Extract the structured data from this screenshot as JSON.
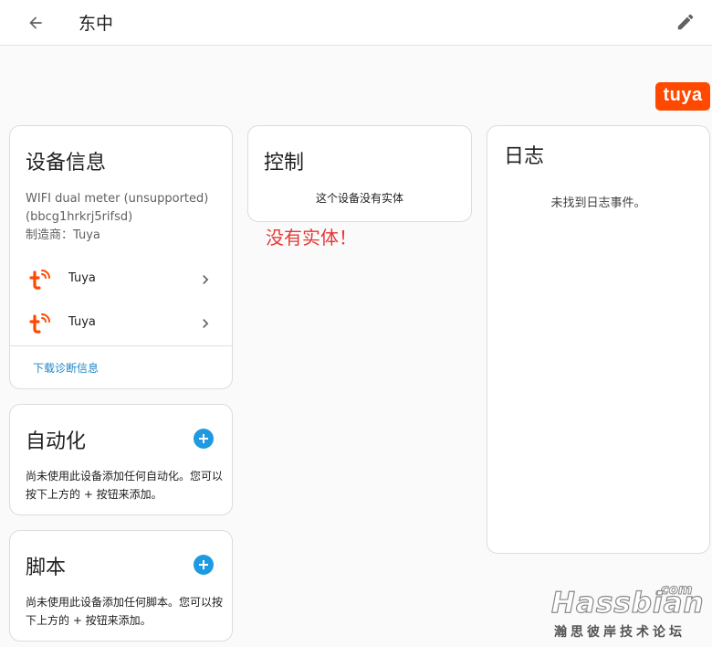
{
  "header": {
    "title": "东中",
    "back_icon": "arrow-left-icon",
    "edit_icon": "pencil-icon"
  },
  "brand": {
    "logo_text": "tuya",
    "logo_color": "#ff4800"
  },
  "device_info": {
    "title": "设备信息",
    "model": "WIFI dual meter (unsupported)",
    "device_id": "(bbcg1hrkrj5rifsd)",
    "manufacturer": "制造商：Tuya",
    "integrations": [
      {
        "label": "Tuya",
        "icon": "tuya-icon"
      },
      {
        "label": "Tuya",
        "icon": "tuya-icon"
      }
    ],
    "download_label": "下载诊断信息",
    "link_color": "#1e88c7"
  },
  "control": {
    "title": "控制",
    "empty_text": "这个设备没有实体"
  },
  "annotation": {
    "text": "没有实体！",
    "color": "#e53935"
  },
  "logbook": {
    "title": "日志",
    "empty_text": "未找到日志事件。"
  },
  "automation": {
    "title": "自动化",
    "add_icon": "plus-circle-icon",
    "empty_text": "尚未使用此设备添加任何自动化。您可以按下上方的 + 按钮来添加。"
  },
  "script": {
    "title": "脚本",
    "add_icon": "plus-circle-icon",
    "empty_text": "尚未使用此设备添加任何脚本。您可以按下上方的 + 按钮来添加。"
  },
  "watermark": {
    "com": ".com",
    "main": "Hassbian",
    "sub": "瀚思彼岸技术论坛"
  },
  "accent_color": "#1e9be0"
}
